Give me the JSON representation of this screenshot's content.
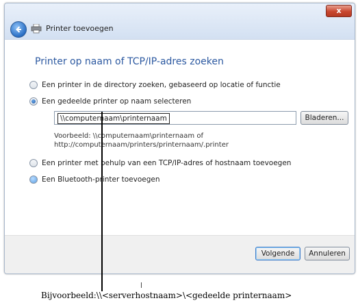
{
  "window": {
    "title": "Printer toevoegen",
    "close_label": "x"
  },
  "main": {
    "heading": "Printer op naam of TCP/IP-adres zoeken",
    "options": [
      {
        "label": "Een printer in de directory zoeken, gebaseerd op locatie of functie",
        "selected": false
      },
      {
        "label": "Een gedeelde printer op naam selecteren",
        "selected": true
      },
      {
        "label": "Een printer met behulp van een TCP/IP-adres of hostnaam toevoegen",
        "selected": false
      },
      {
        "label": "Een Bluetooth-printer toevoegen",
        "selected": false
      }
    ],
    "name_field_value": "\\\\computernaam\\printernaam",
    "browse_label": "Bladeren...",
    "example_line1": "Voorbeeld: \\\\computernaam\\printernaam of",
    "example_line2": "http://computernaam/printers/printernaam/.printer"
  },
  "footer": {
    "next_label": "Volgende",
    "cancel_label": "Annuleren"
  },
  "annotation": {
    "caption": "Bijvoorbeeld:\\\\<serverhostnaam>\\<gedeelde printernaam>"
  }
}
